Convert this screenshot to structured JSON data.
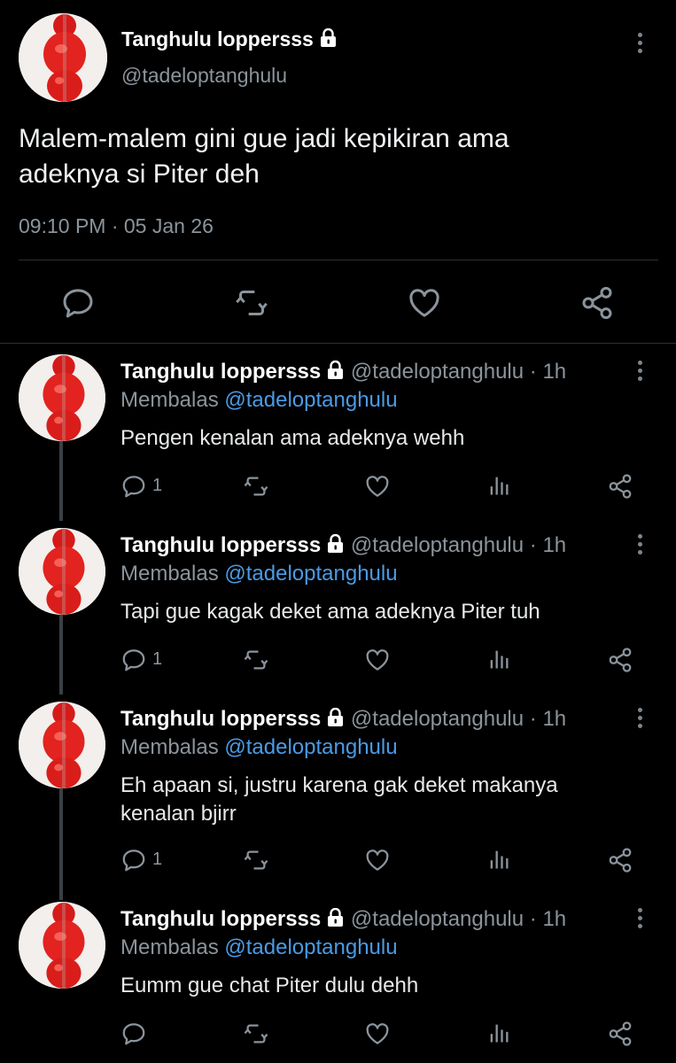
{
  "main_tweet": {
    "display_name": "Tanghulu loppersss",
    "handle": "@tadeloptanghulu",
    "text_line1": "Malem-malem gini gue jadi kepikiran ama",
    "text_line2": "adeknya si Piter deh",
    "timestamp": "09:10 PM · 05 Jan 26"
  },
  "replies": [
    {
      "display_name": "Tanghulu loppersss",
      "handle": "@tadeloptanghulu",
      "time": "· 1h",
      "replying_label": "Membalas",
      "replying_to": "@tadeloptanghulu",
      "text_line1": "Pengen kenalan ama adeknya wehh",
      "text_line2": "",
      "reply_count": "1"
    },
    {
      "display_name": "Tanghulu loppersss",
      "handle": "@tadeloptanghulu",
      "time": "· 1h",
      "replying_label": "Membalas",
      "replying_to": "@tadeloptanghulu",
      "text_line1": "Tapi gue kagak deket ama adeknya Piter tuh",
      "text_line2": "",
      "reply_count": "1"
    },
    {
      "display_name": "Tanghulu loppersss",
      "handle": "@tadeloptanghulu",
      "time": "· 1h",
      "replying_label": "Membalas",
      "replying_to": "@tadeloptanghulu",
      "text_line1": "Eh apaan si, justru karena gak deket makanya",
      "text_line2": "kenalan bjirr",
      "reply_count": "1"
    },
    {
      "display_name": "Tanghulu loppersss",
      "handle": "@tadeloptanghulu",
      "time": "· 1h",
      "replying_label": "Membalas",
      "replying_to": "@tadeloptanghulu",
      "text_line1": "Eumm gue chat Piter dulu dehh",
      "text_line2": "",
      "reply_count": ""
    }
  ],
  "icons": {
    "reply": "reply-bubble-icon",
    "retweet": "retweet-icon",
    "like": "heart-icon",
    "views": "views-bar-icon",
    "share": "share-icon",
    "lock": "lock-icon",
    "more": "more-vertical-icon"
  },
  "colors": {
    "background": "#000000",
    "text": "#e7e9ea",
    "muted": "#8b949c",
    "link": "#4a9be6",
    "icon": "#8b949c"
  }
}
